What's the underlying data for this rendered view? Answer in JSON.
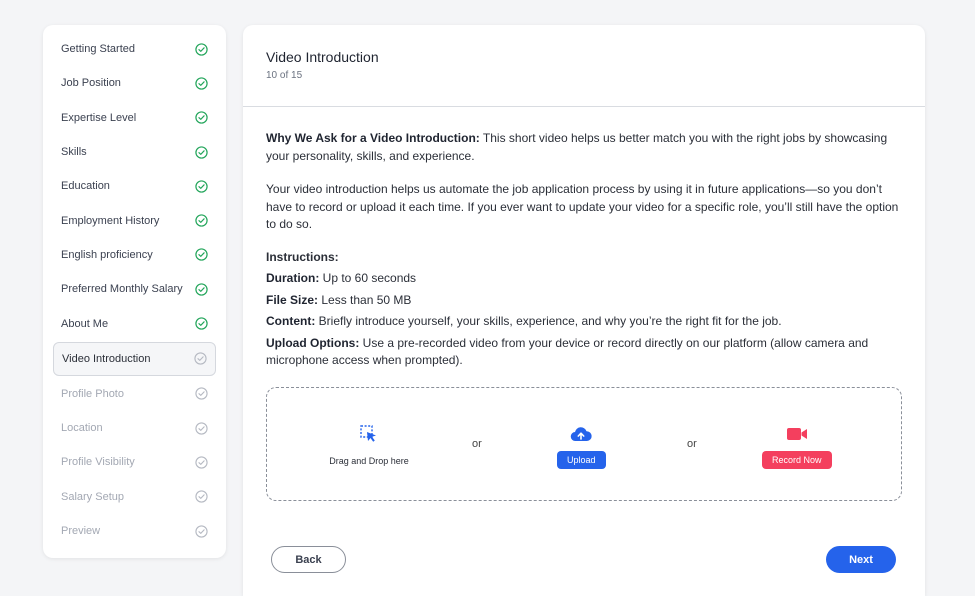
{
  "sidebar": {
    "steps": [
      {
        "label": "Getting Started",
        "status": "done"
      },
      {
        "label": "Job Position",
        "status": "done"
      },
      {
        "label": "Expertise Level",
        "status": "done"
      },
      {
        "label": "Skills",
        "status": "done"
      },
      {
        "label": "Education",
        "status": "done"
      },
      {
        "label": "Employment History",
        "status": "done"
      },
      {
        "label": "English proficiency",
        "status": "done"
      },
      {
        "label": "Preferred Monthly Salary",
        "status": "done"
      },
      {
        "label": "About Me",
        "status": "done"
      },
      {
        "label": "Video Introduction",
        "status": "active"
      },
      {
        "label": "Profile Photo",
        "status": "pending"
      },
      {
        "label": "Location",
        "status": "pending"
      },
      {
        "label": "Profile Visibility",
        "status": "pending"
      },
      {
        "label": "Salary Setup",
        "status": "pending"
      },
      {
        "label": "Preview",
        "status": "pending"
      }
    ]
  },
  "main": {
    "title": "Video Introduction",
    "progress": "10 of 15",
    "why_label": "Why We Ask for a Video Introduction:",
    "why_text": " This short video helps us better match you with the right jobs by showcasing your personality, skills, and experience.",
    "automate_text": "Your video introduction helps us automate the job application process by using it in future applications—so you don’t have to record or upload it each time. If you ever want to update your video for a specific role, you’ll still have the option to do so.",
    "instructions_title": "Instructions:",
    "instructions": [
      {
        "label": "Duration:",
        "text": " Up to 60 seconds"
      },
      {
        "label": "File Size:",
        "text": " Less than 50 MB"
      },
      {
        "label": "Content:",
        "text": " Briefly introduce yourself, your skills, experience, and why you’re the right fit for the job."
      },
      {
        "label": "Upload Options:",
        "text": " Use a pre-recorded video from your device or record directly on our platform (allow camera and microphone access when prompted)."
      }
    ],
    "dropzone": {
      "drag_label": "Drag and Drop here",
      "or_1": "or",
      "or_2": "or",
      "upload_label": "Upload",
      "record_label": "Record Now"
    },
    "back_label": "Back",
    "next_label": "Next"
  },
  "colors": {
    "primary": "#2563eb",
    "record": "#f43f5e",
    "done_check": "#22a55a",
    "pending_check": "#b5b9c2"
  },
  "icons": {
    "done": "check-circle-icon",
    "pending": "check-circle-outline-icon",
    "drag": "drag-drop-icon",
    "upload": "cloud-upload-icon",
    "record": "video-camera-icon"
  }
}
